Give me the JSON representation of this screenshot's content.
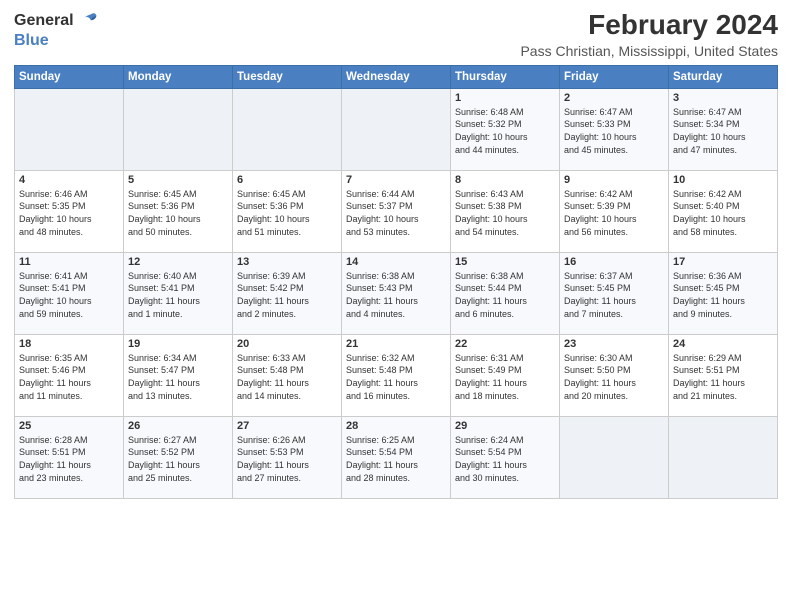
{
  "logo": {
    "general": "General",
    "blue": "Blue"
  },
  "title": "February 2024",
  "subtitle": "Pass Christian, Mississippi, United States",
  "days_header": [
    "Sunday",
    "Monday",
    "Tuesday",
    "Wednesday",
    "Thursday",
    "Friday",
    "Saturday"
  ],
  "weeks": [
    [
      {
        "day": "",
        "info": ""
      },
      {
        "day": "",
        "info": ""
      },
      {
        "day": "",
        "info": ""
      },
      {
        "day": "",
        "info": ""
      },
      {
        "day": "1",
        "info": "Sunrise: 6:48 AM\nSunset: 5:32 PM\nDaylight: 10 hours\nand 44 minutes."
      },
      {
        "day": "2",
        "info": "Sunrise: 6:47 AM\nSunset: 5:33 PM\nDaylight: 10 hours\nand 45 minutes."
      },
      {
        "day": "3",
        "info": "Sunrise: 6:47 AM\nSunset: 5:34 PM\nDaylight: 10 hours\nand 47 minutes."
      }
    ],
    [
      {
        "day": "4",
        "info": "Sunrise: 6:46 AM\nSunset: 5:35 PM\nDaylight: 10 hours\nand 48 minutes."
      },
      {
        "day": "5",
        "info": "Sunrise: 6:45 AM\nSunset: 5:36 PM\nDaylight: 10 hours\nand 50 minutes."
      },
      {
        "day": "6",
        "info": "Sunrise: 6:45 AM\nSunset: 5:36 PM\nDaylight: 10 hours\nand 51 minutes."
      },
      {
        "day": "7",
        "info": "Sunrise: 6:44 AM\nSunset: 5:37 PM\nDaylight: 10 hours\nand 53 minutes."
      },
      {
        "day": "8",
        "info": "Sunrise: 6:43 AM\nSunset: 5:38 PM\nDaylight: 10 hours\nand 54 minutes."
      },
      {
        "day": "9",
        "info": "Sunrise: 6:42 AM\nSunset: 5:39 PM\nDaylight: 10 hours\nand 56 minutes."
      },
      {
        "day": "10",
        "info": "Sunrise: 6:42 AM\nSunset: 5:40 PM\nDaylight: 10 hours\nand 58 minutes."
      }
    ],
    [
      {
        "day": "11",
        "info": "Sunrise: 6:41 AM\nSunset: 5:41 PM\nDaylight: 10 hours\nand 59 minutes."
      },
      {
        "day": "12",
        "info": "Sunrise: 6:40 AM\nSunset: 5:41 PM\nDaylight: 11 hours\nand 1 minute."
      },
      {
        "day": "13",
        "info": "Sunrise: 6:39 AM\nSunset: 5:42 PM\nDaylight: 11 hours\nand 2 minutes."
      },
      {
        "day": "14",
        "info": "Sunrise: 6:38 AM\nSunset: 5:43 PM\nDaylight: 11 hours\nand 4 minutes."
      },
      {
        "day": "15",
        "info": "Sunrise: 6:38 AM\nSunset: 5:44 PM\nDaylight: 11 hours\nand 6 minutes."
      },
      {
        "day": "16",
        "info": "Sunrise: 6:37 AM\nSunset: 5:45 PM\nDaylight: 11 hours\nand 7 minutes."
      },
      {
        "day": "17",
        "info": "Sunrise: 6:36 AM\nSunset: 5:45 PM\nDaylight: 11 hours\nand 9 minutes."
      }
    ],
    [
      {
        "day": "18",
        "info": "Sunrise: 6:35 AM\nSunset: 5:46 PM\nDaylight: 11 hours\nand 11 minutes."
      },
      {
        "day": "19",
        "info": "Sunrise: 6:34 AM\nSunset: 5:47 PM\nDaylight: 11 hours\nand 13 minutes."
      },
      {
        "day": "20",
        "info": "Sunrise: 6:33 AM\nSunset: 5:48 PM\nDaylight: 11 hours\nand 14 minutes."
      },
      {
        "day": "21",
        "info": "Sunrise: 6:32 AM\nSunset: 5:48 PM\nDaylight: 11 hours\nand 16 minutes."
      },
      {
        "day": "22",
        "info": "Sunrise: 6:31 AM\nSunset: 5:49 PM\nDaylight: 11 hours\nand 18 minutes."
      },
      {
        "day": "23",
        "info": "Sunrise: 6:30 AM\nSunset: 5:50 PM\nDaylight: 11 hours\nand 20 minutes."
      },
      {
        "day": "24",
        "info": "Sunrise: 6:29 AM\nSunset: 5:51 PM\nDaylight: 11 hours\nand 21 minutes."
      }
    ],
    [
      {
        "day": "25",
        "info": "Sunrise: 6:28 AM\nSunset: 5:51 PM\nDaylight: 11 hours\nand 23 minutes."
      },
      {
        "day": "26",
        "info": "Sunrise: 6:27 AM\nSunset: 5:52 PM\nDaylight: 11 hours\nand 25 minutes."
      },
      {
        "day": "27",
        "info": "Sunrise: 6:26 AM\nSunset: 5:53 PM\nDaylight: 11 hours\nand 27 minutes."
      },
      {
        "day": "28",
        "info": "Sunrise: 6:25 AM\nSunset: 5:54 PM\nDaylight: 11 hours\nand 28 minutes."
      },
      {
        "day": "29",
        "info": "Sunrise: 6:24 AM\nSunset: 5:54 PM\nDaylight: 11 hours\nand 30 minutes."
      },
      {
        "day": "",
        "info": ""
      },
      {
        "day": "",
        "info": ""
      }
    ]
  ]
}
